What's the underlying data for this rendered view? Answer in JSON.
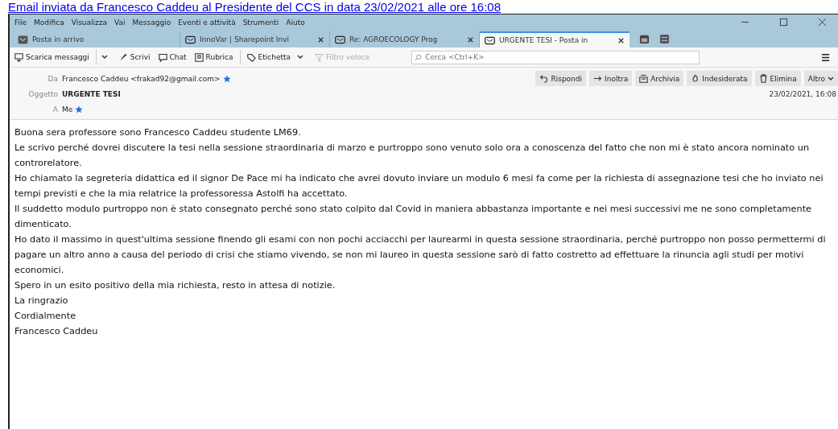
{
  "caption": "Email inviata da Francesco Caddeu al Presidente del CCS in data 23/02/2021 alle ore 16:08",
  "menu": [
    "File",
    "Modifica",
    "Visualizza",
    "Vai",
    "Messaggio",
    "Eventi e attività",
    "Strumenti",
    "Aiuto"
  ],
  "tabs": [
    {
      "label": "Posta in arrivo",
      "kind": "inbox",
      "selected": false
    },
    {
      "label": "InnoVar | Sharepoint Invi",
      "kind": "mail",
      "selected": false
    },
    {
      "label": "Re: AGROECOLOGY Prog",
      "kind": "mail",
      "selected": false
    },
    {
      "label": "URGENTE TESI - Posta in",
      "kind": "mail",
      "selected": true
    }
  ],
  "toolbar": [
    {
      "label": "Scarica messaggi",
      "kind": "download",
      "disabled": false
    },
    {
      "label": "Scrivi",
      "kind": "write",
      "disabled": false
    },
    {
      "label": "Chat",
      "kind": "chat",
      "disabled": false
    },
    {
      "label": "Rubrica",
      "kind": "book",
      "disabled": false
    },
    {
      "label": "Etichetta",
      "kind": "tag",
      "disabled": false
    },
    {
      "label": "Filtro veloce",
      "kind": "filter",
      "disabled": true
    }
  ],
  "search": {
    "placeholder": "Cerca <Ctrl+K>"
  },
  "header": {
    "from_label": "Da",
    "from": "Francesco Caddeu <frakad92@gmail.com>",
    "subject_label": "Oggetto",
    "subject": "URGENTE TESI",
    "to_label": "A",
    "to": "Me",
    "date": "23/02/2021, 16:08"
  },
  "actions": [
    {
      "label": "Rispondi",
      "kind": "reply"
    },
    {
      "label": "Inoltra",
      "kind": "forward"
    },
    {
      "label": "Archivia",
      "kind": "archive"
    },
    {
      "label": "Indesiderata",
      "kind": "junk"
    },
    {
      "label": "Elimina",
      "kind": "delete"
    },
    {
      "label": "Altro",
      "kind": "more"
    }
  ],
  "body": [
    "Buona sera professore sono Francesco Caddeu studente LM69.",
    "Le scrivo perché dovrei discutere la tesi nella sessione straordinaria di marzo e  purtroppo sono venuto solo ora a conoscenza del fatto che non mi è stato ancora nominato un controrelatore.",
    "Ho chiamato la segreteria didattica ed il signor De Pace mi ha indicato che avrei dovuto inviare un modulo 6 mesi fa come per la richiesta di assegnazione tesi che ho inviato nei tempi previsti e che la mia relatrice la professoressa Astolfi ha accettato.",
    "Il suddetto modulo purtroppo non è stato consegnato perché sono stato colpito dal Covid in maniera abbastanza importante e nei mesi successivi me ne sono completamente dimenticato.",
    "Ho dato il massimo in quest'ultima sessione finendo gli esami con non pochi acciacchi per laurearmi in questa sessione straordinaria, perché purtroppo non posso permettermi di pagare un altro anno a causa del periodo di crisi che stiamo vivendo, se non mi laureo in questa sessione sarò di fatto costretto ad effettuare la rinuncia agli studi per motivi economici.",
    "Spero in un esito positivo della mia richiesta, resto in attesa di notizie.",
    "La ringrazio",
    "Cordialmente"
  ],
  "signature": "Francesco Caddeu"
}
